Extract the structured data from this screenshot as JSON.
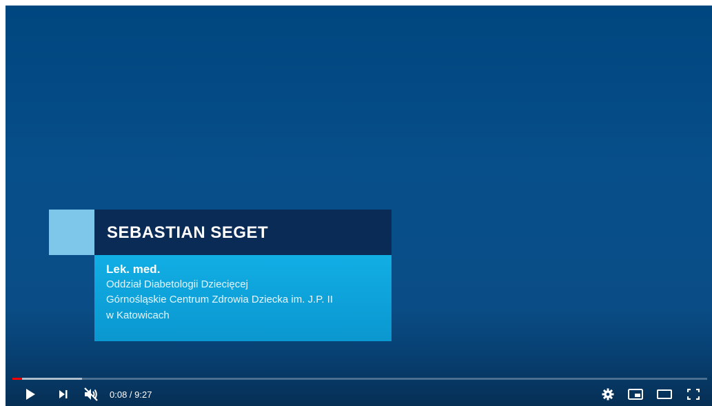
{
  "lower_third": {
    "name": "SEBASTIAN SEGET",
    "title": "Lek. med.",
    "line1": "Oddział Diabetologii Dziecięcej",
    "line2": "Górnośląskie Centrum Zdrowia Dziecka im. J.P. II",
    "line3": "w Katowicach"
  },
  "player": {
    "current_time": "0:08",
    "separator": " / ",
    "duration": "9:27",
    "progress_fraction": 0.014,
    "buffered_fraction": 0.1
  },
  "controls": {
    "left": [
      "play-icon",
      "next-icon",
      "volume-muted-icon"
    ],
    "right": [
      "settings-gear-icon",
      "miniplayer-icon",
      "theater-mode-icon",
      "fullscreen-icon"
    ]
  },
  "colors": {
    "background": "#00467f",
    "accent_square": "#7ec7ea",
    "name_bar": "#0b2b57",
    "info_box": "#11aee4",
    "progress_played": "#ff0000"
  }
}
